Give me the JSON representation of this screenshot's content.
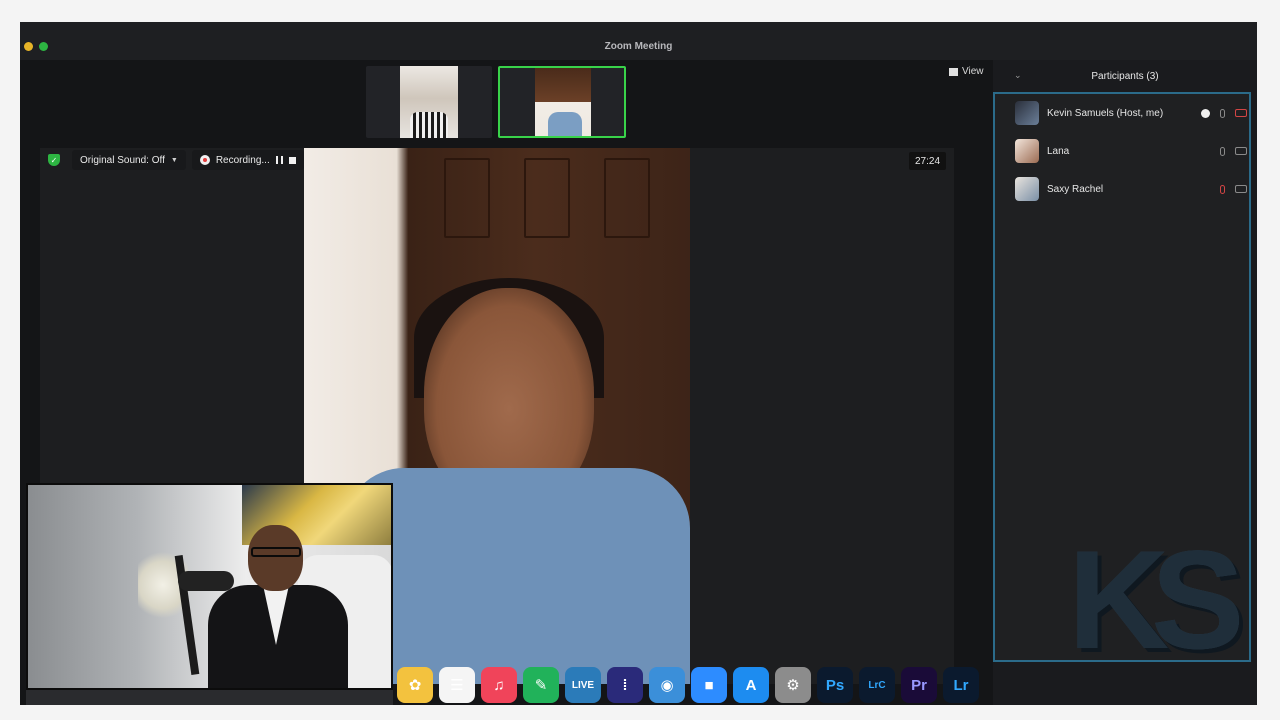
{
  "window": {
    "title": "Zoom Meeting"
  },
  "toolbar": {
    "view_label": "View",
    "original_sound": "Original Sound: Off",
    "recording": "Recording...",
    "timer": "27:24"
  },
  "participants": {
    "title": "Participants (3)",
    "list": [
      {
        "name": "Kevin Samuels (Host, me)",
        "mic_muted": false,
        "video_off": true
      },
      {
        "name": "Lana",
        "mic_muted": false,
        "video_off": false
      },
      {
        "name": "Saxy Rachel",
        "mic_muted": true,
        "video_off": false
      }
    ]
  },
  "logo": {
    "text": "KS"
  },
  "dock": {
    "items": [
      {
        "name": "photos-icon",
        "color": "#f3c23e",
        "glyph": "✿"
      },
      {
        "name": "reminders-icon",
        "color": "#f5f5f5",
        "glyph": "☰"
      },
      {
        "name": "music-icon",
        "color": "#f0445a",
        "glyph": "♫"
      },
      {
        "name": "evernote-icon",
        "color": "#21b25a",
        "glyph": "✎"
      },
      {
        "name": "live-icon",
        "color": "#2b7bb9",
        "glyph": "LIVE"
      },
      {
        "name": "launchpad-icon",
        "color": "#2a2a7a",
        "glyph": "⁞"
      },
      {
        "name": "quicktime-icon",
        "color": "#3b8fd9",
        "glyph": "◉"
      },
      {
        "name": "zoom-icon",
        "color": "#2d8cff",
        "glyph": "■"
      },
      {
        "name": "app-store-icon",
        "color": "#1d8cf0",
        "glyph": "A"
      },
      {
        "name": "settings-icon",
        "color": "#8c8c8c",
        "glyph": "⚙"
      },
      {
        "name": "photoshop-icon",
        "color": "#0b1a2e",
        "glyph": "Ps",
        "fg": "#31a8ff"
      },
      {
        "name": "lightroom-classic-icon",
        "color": "#0b1a2e",
        "glyph": "LrC",
        "fg": "#31a8ff"
      },
      {
        "name": "premiere-icon",
        "color": "#1a0b38",
        "glyph": "Pr",
        "fg": "#9999ff"
      },
      {
        "name": "lightroom-icon",
        "color": "#0b1a2e",
        "glyph": "Lr",
        "fg": "#31a8ff"
      }
    ]
  }
}
